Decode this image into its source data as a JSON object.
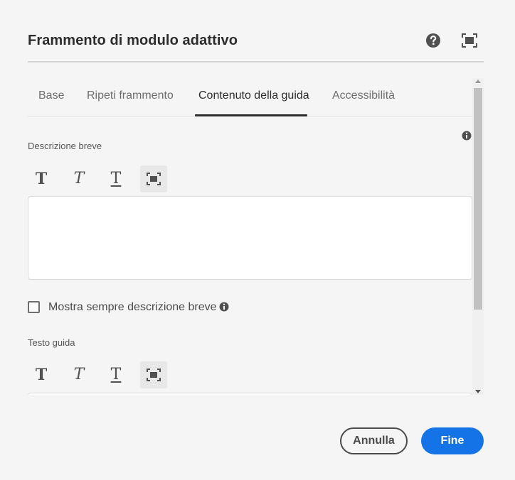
{
  "dialog": {
    "title": "Frammento di modulo adattivo"
  },
  "tabs": [
    {
      "label": "Base",
      "active": false
    },
    {
      "label": "Ripeti frammento",
      "active": false
    },
    {
      "label": "Contenuto della guida",
      "active": true
    },
    {
      "label": "Accessibilità",
      "active": false
    }
  ],
  "short_description": {
    "label": "Descrizione breve",
    "value": "",
    "toolbar": [
      "bold-icon",
      "italic-icon",
      "underline-icon",
      "fullscreen-icon"
    ]
  },
  "always_show": {
    "label": "Mostra sempre descrizione breve",
    "checked": false
  },
  "help_text": {
    "label": "Testo guida",
    "value": "",
    "toolbar": [
      "bold-icon",
      "italic-icon",
      "underline-icon",
      "fullscreen-icon"
    ]
  },
  "footer": {
    "cancel_label": "Annulla",
    "done_label": "Fine"
  },
  "glyphs": {
    "bold": "T",
    "italic": "T",
    "underline": "T"
  },
  "colors": {
    "accent": "#1473e6",
    "background": "#f5f5f5",
    "text": "#2c2c2c"
  }
}
